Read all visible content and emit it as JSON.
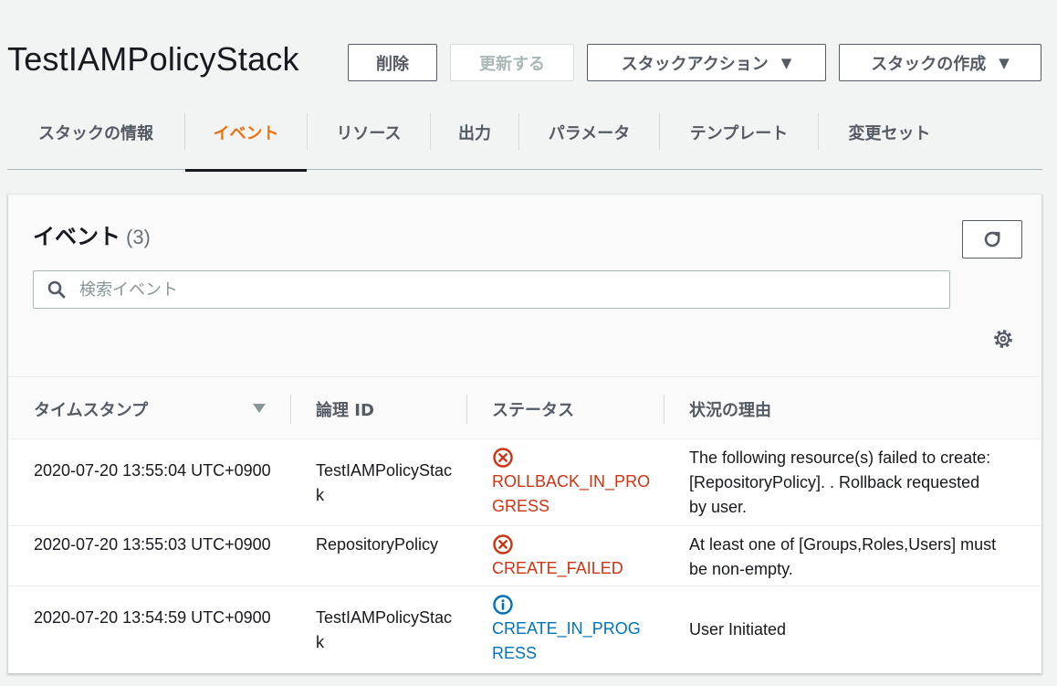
{
  "header": {
    "stack_name": "TestIAMPolicyStack",
    "delete_label": "削除",
    "update_label": "更新する",
    "stack_actions_label": "スタックアクション",
    "create_stack_label": "スタックの作成"
  },
  "tabs": [
    {
      "label": "スタックの情報",
      "active": false
    },
    {
      "label": "イベント",
      "active": true
    },
    {
      "label": "リソース",
      "active": false
    },
    {
      "label": "出力",
      "active": false
    },
    {
      "label": "パラメータ",
      "active": false
    },
    {
      "label": "テンプレート",
      "active": false
    },
    {
      "label": "変更セット",
      "active": false
    }
  ],
  "events_panel": {
    "title": "イベント",
    "count": "(3)",
    "search_placeholder": "検索イベント"
  },
  "table": {
    "columns": [
      "タイムスタンプ",
      "論理 ID",
      "ステータス",
      "状況の理由"
    ],
    "rows": [
      {
        "timestamp": "2020-07-20 13:55:04 UTC+0900",
        "logical_id": "TestIAMPolicyStack",
        "status": "ROLLBACK_IN_PROGRESS",
        "status_type": "error",
        "reason": "The following resource(s) failed to create: [RepositoryPolicy]. . Rollback requested by user."
      },
      {
        "timestamp": "2020-07-20 13:55:03 UTC+0900",
        "logical_id": "RepositoryPolicy",
        "status": "CREATE_FAILED",
        "status_type": "error",
        "reason": "At least one of [Groups,Roles,Users] must be non-empty."
      },
      {
        "timestamp": "2020-07-20 13:54:59 UTC+0900",
        "logical_id": "TestIAMPolicyStack",
        "status": "CREATE_IN_PROGRESS",
        "status_type": "info",
        "reason": "User Initiated"
      }
    ]
  },
  "colors": {
    "accent": "#ec7211",
    "error": "#d13212",
    "info": "#0073bb"
  }
}
